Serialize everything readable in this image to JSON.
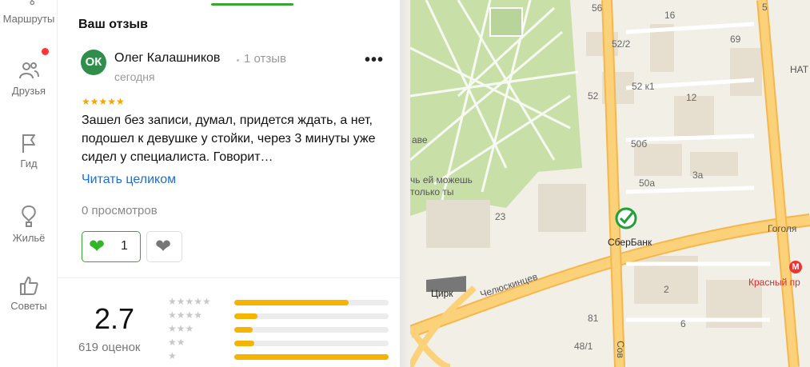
{
  "nav": {
    "items": [
      {
        "label": "Маршруты"
      },
      {
        "label": "Друзья"
      },
      {
        "label": "Гид"
      },
      {
        "label": "Жильё"
      },
      {
        "label": "Советы"
      }
    ]
  },
  "review": {
    "title": "Ваш отзыв",
    "avatar_initials": "ОК",
    "author": "Олег Калашников",
    "author_reviews": "1 отзыв",
    "date": "сегодня",
    "rating": 5,
    "stars": "★★★★★",
    "text": "Зашел без записи, думал, придется ждать, а нет, подошел к девушке у стойки, через 3 минуты уже сидел у специалиста. Говорит…",
    "read_more": "Читать целиком",
    "views": "0 просмотров",
    "likes": "1",
    "more_icon": "•••"
  },
  "summary": {
    "score": "2.7",
    "count": "619 оценок",
    "distribution": [
      {
        "stars": "★★★★★",
        "fraction": 0.74
      },
      {
        "stars": "★★★★",
        "fraction": 0.15
      },
      {
        "stars": "★★★",
        "fraction": 0.12
      },
      {
        "stars": "★★",
        "fraction": 0.13
      },
      {
        "stars": "★",
        "fraction": 1.0
      }
    ]
  },
  "colors": {
    "accent_green": "#36a531",
    "link_blue": "#1f6fc9",
    "star_gold": "#f5a400",
    "bar_fill": "#f5b400"
  },
  "map": {
    "labels": {
      "sberbank": "СберБанк",
      "circus": "Цирк",
      "chelyuskintsev": "Челюскинцев",
      "gogolya": "Гоголя",
      "krasny": "Красный пр",
      "nata": "НАТ",
      "ave": "аве",
      "monument1": "чь ей можешь",
      "monument2": "только ты",
      "sov": "Сов"
    },
    "numbers": [
      "56",
      "52/2",
      "52 к1",
      "52",
      "12",
      "50б",
      "3а",
      "50а",
      "69",
      "23",
      "2",
      "6",
      "81",
      "48/1",
      "16",
      "5"
    ]
  }
}
